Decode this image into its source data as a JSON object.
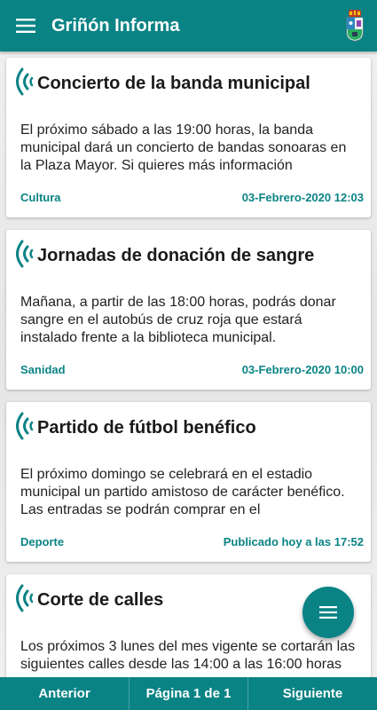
{
  "appbar": {
    "title": "Griñón Informa",
    "menu_icon": "hamburger-menu-icon",
    "crest_icon": "municipal-crest-icon"
  },
  "colors": {
    "primary": "#0a8385",
    "text": "#222222",
    "card_bg": "#ffffff"
  },
  "news": [
    {
      "icon": "broadcast-icon",
      "title": "Concierto de la banda municipal",
      "body": "El próximo sábado a las 19:00 horas, la banda municipal dará un concierto de bandas sonoaras en la Plaza Mayor. Si quieres más información",
      "category": "Cultura",
      "date": "03-Febrero-2020 12:03"
    },
    {
      "icon": "broadcast-icon",
      "title": "Jornadas de donación de sangre",
      "body": "Mañana, a partir de las 18:00 horas, podrás donar sangre en el autobús de cruz roja que estará instalado frente a la biblioteca municipal.",
      "category": "Sanidad",
      "date": "03-Febrero-2020 10:00"
    },
    {
      "icon": "broadcast-icon",
      "title": "Partido de fútbol benéfico",
      "body": "El próximo domingo se celebrará en el estadio municipal un partido amistoso de carácter benéfico. Las entradas se podrán comprar en el",
      "category": "Deporte",
      "date": "Publicado hoy a las 17:52"
    },
    {
      "icon": "broadcast-icon",
      "title": "Corte de calles",
      "body": "Los próximos 3 lunes del mes vigente se cortarán las siguientes calles desde las 14:00 a las 16:00 horas",
      "category": "",
      "date": ""
    }
  ],
  "fab": {
    "icon": "list-menu-icon"
  },
  "pager": {
    "prev_label": "Anterior",
    "page_label": "Página 1 de 1",
    "next_label": "Siguiente"
  }
}
